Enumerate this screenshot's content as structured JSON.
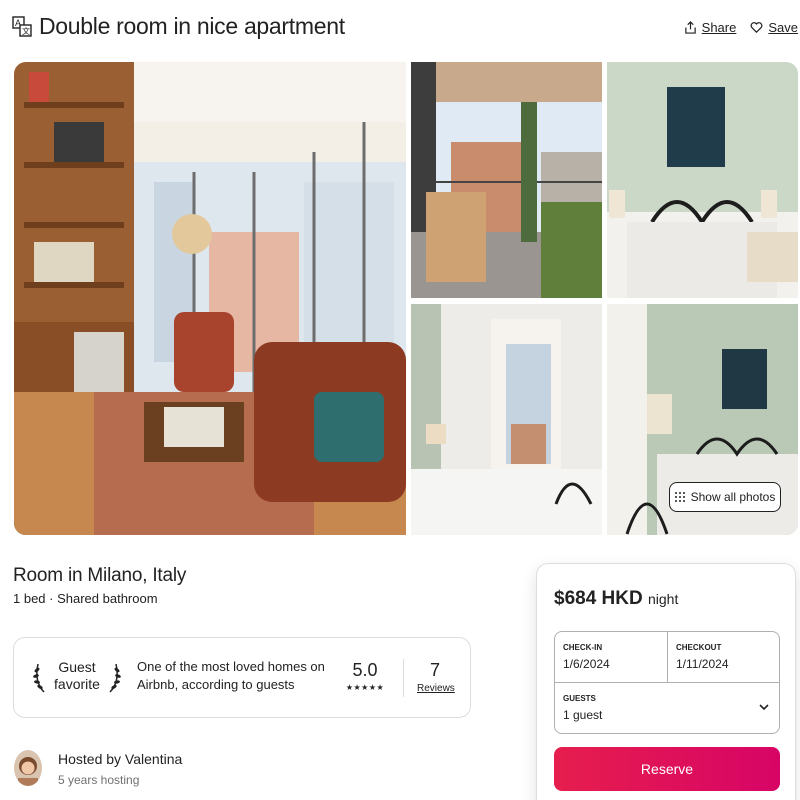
{
  "header": {
    "title": "Double room in nice apartment",
    "translate_icon": "translate-icon",
    "share_label": "Share",
    "save_label": "Save"
  },
  "gallery": {
    "show_all_label": "Show all photos",
    "photos": [
      {
        "name": "living-room-photo"
      },
      {
        "name": "balcony-photo"
      },
      {
        "name": "bedroom-photo"
      },
      {
        "name": "bedroom-window-photo"
      },
      {
        "name": "bedroom-wardrobe-photo"
      }
    ]
  },
  "listing": {
    "title": "Room in Milano, Italy",
    "subtitle": "1 bed · Shared bathroom"
  },
  "guest_favorite": {
    "label_line1": "Guest",
    "label_line2": "favorite",
    "description": "One of the most loved homes on Airbnb, according to guests",
    "rating": "5.0",
    "stars": "★★★★★",
    "reviews_count": "7",
    "reviews_label": "Reviews"
  },
  "host": {
    "name": "Hosted by Valentina",
    "years": "5 years hosting"
  },
  "booking": {
    "price": "$684 HKD",
    "price_unit": "night",
    "checkin_label": "CHECK-IN",
    "checkin_value": "1/6/2024",
    "checkout_label": "CHECKOUT",
    "checkout_value": "1/11/2024",
    "guests_label": "GUESTS",
    "guests_value": "1 guest",
    "reserve_label": "Reserve"
  },
  "colors": {
    "brand": "#e61e4d",
    "text": "#222222",
    "muted": "#717171",
    "border": "#dddddd"
  }
}
